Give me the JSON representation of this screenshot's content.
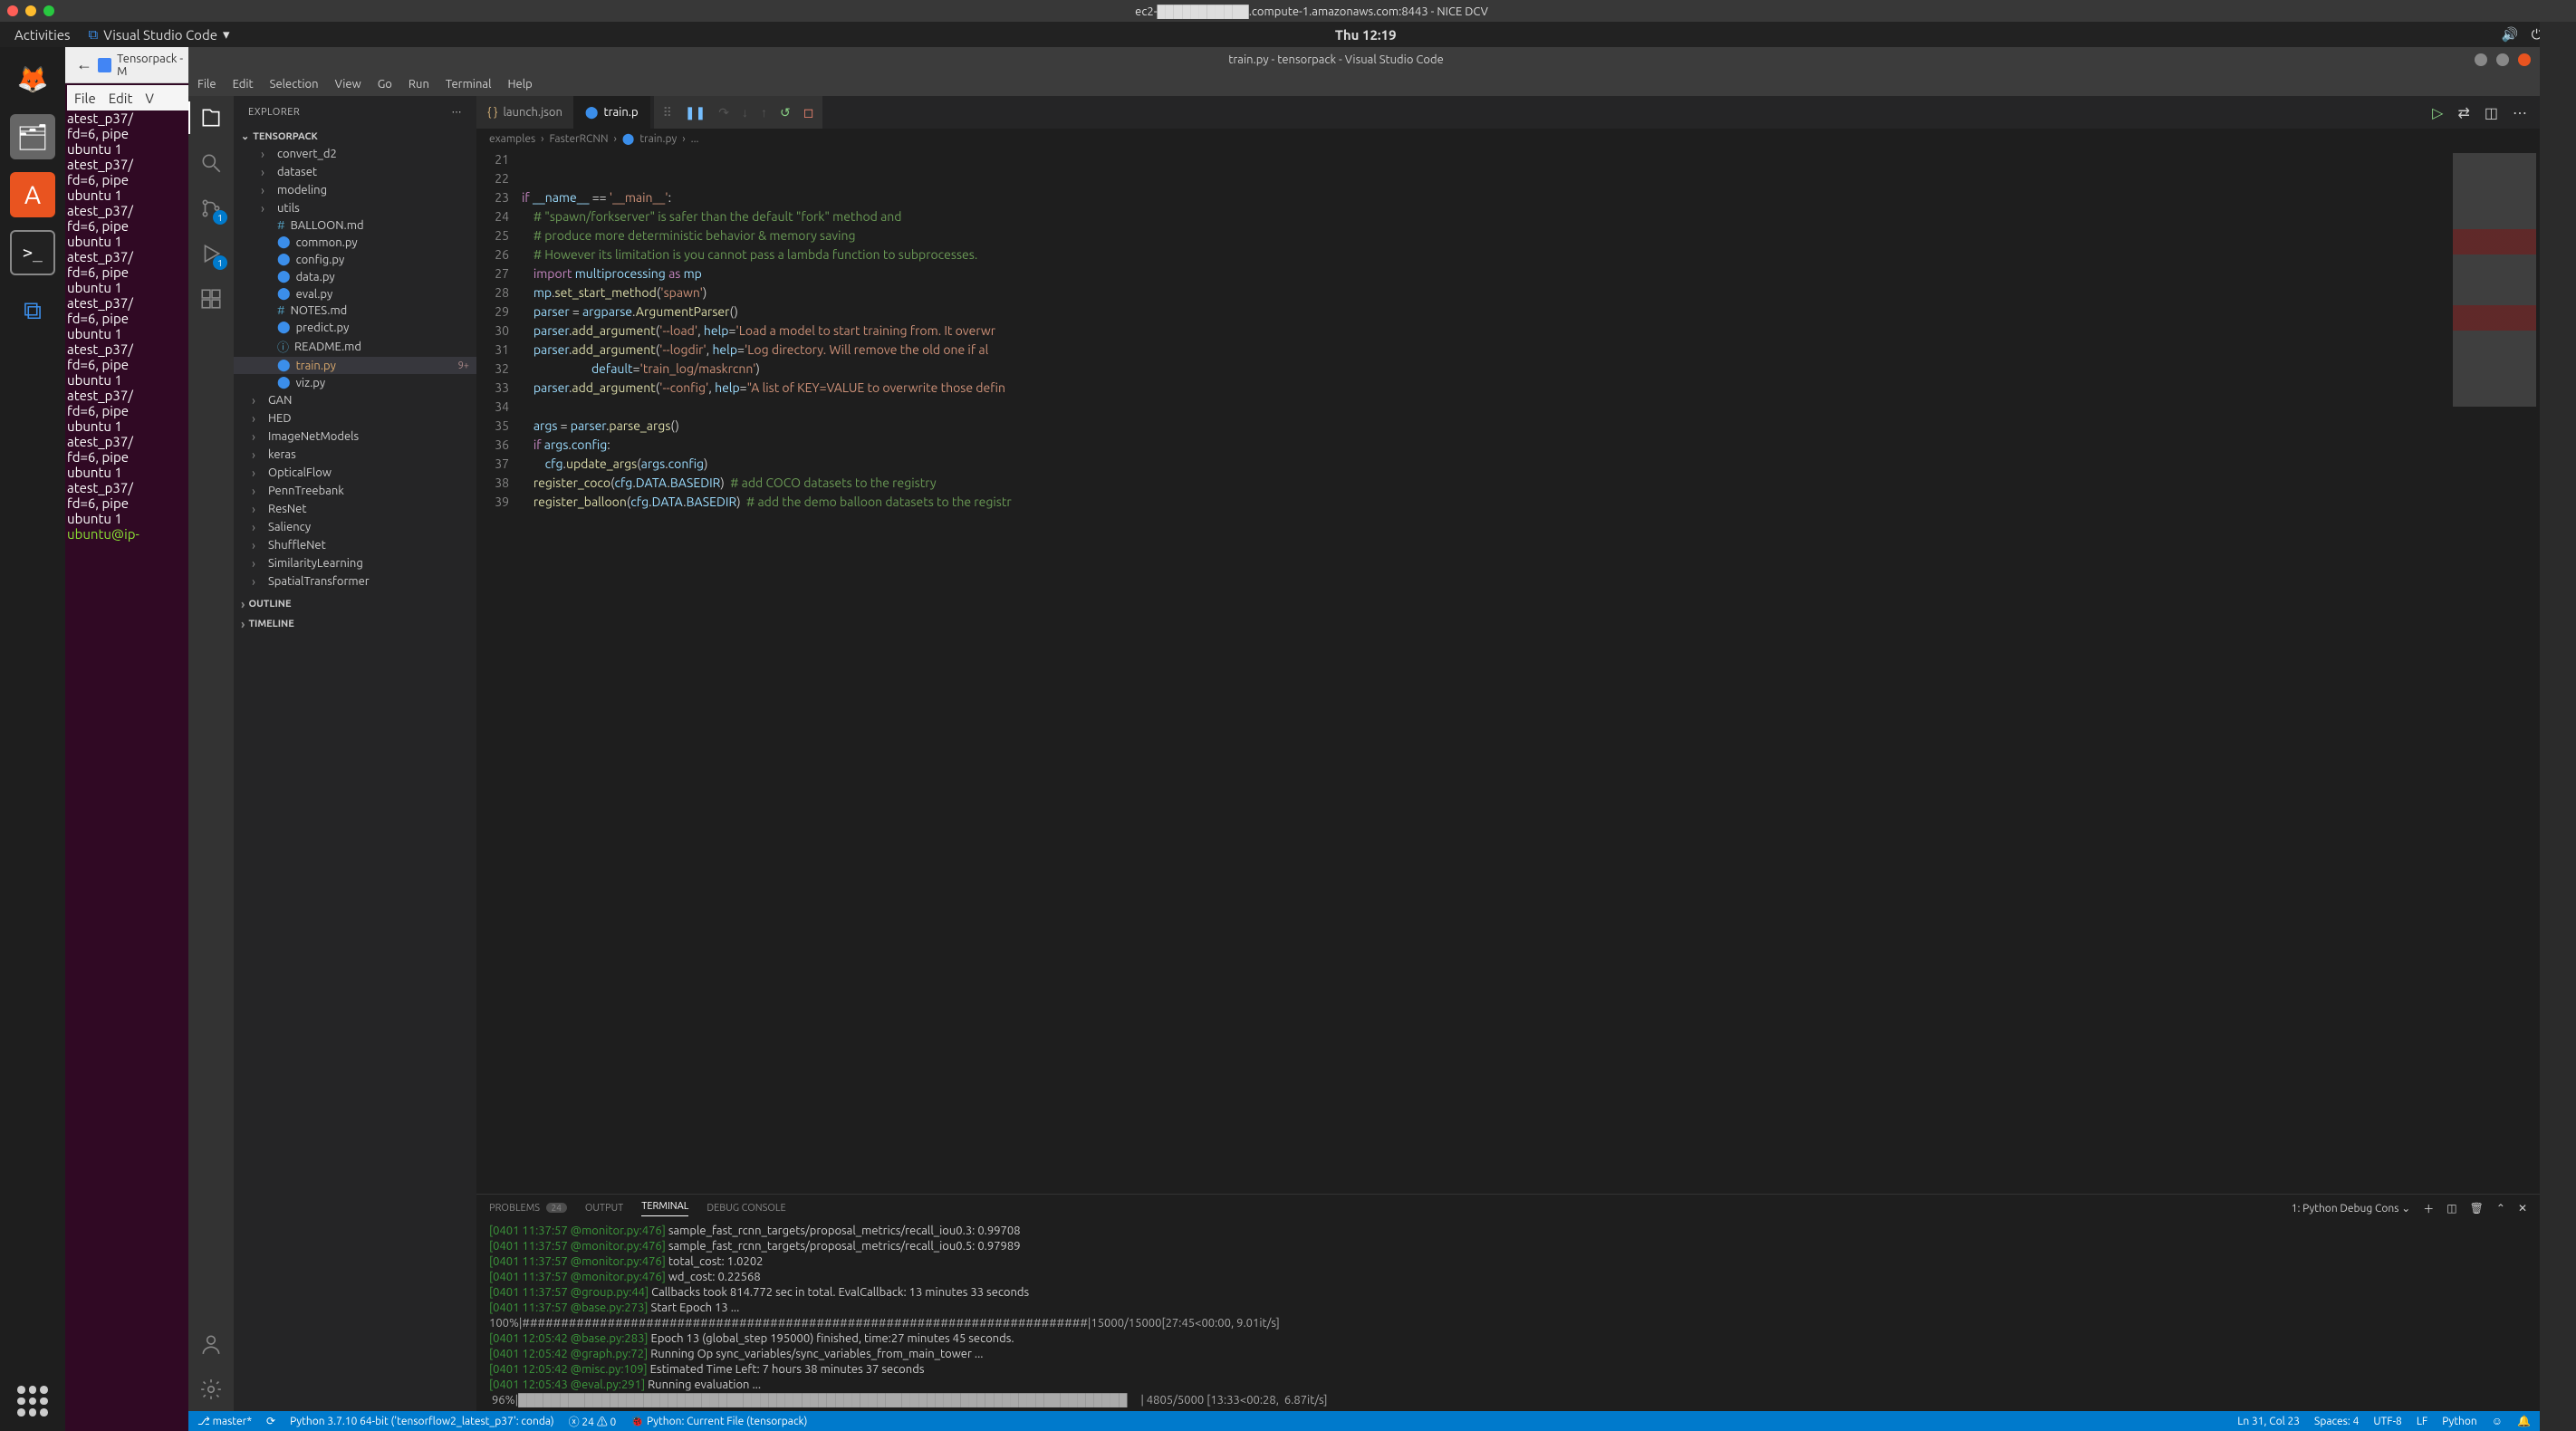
{
  "mac": {
    "title": "ec2-███████████.compute-1.amazonaws.com:8443 - NICE DCV"
  },
  "ubuntu": {
    "activities": "Activities",
    "app": "Visual Studio Code",
    "clock": "Thu 12:19"
  },
  "bg_tab": "Tensorpack - M",
  "bg_term_menu": [
    "File",
    "Edit",
    "V"
  ],
  "bg_term_lines": [
    "atest_p37/",
    "fd=6, pipe",
    "ubuntu   1",
    "atest_p37/",
    "fd=6, pipe",
    "ubuntu   1",
    "atest_p37/",
    "fd=6, pipe",
    "ubuntu   1",
    "atest_p37/",
    "fd=6, pipe",
    "ubuntu   1",
    "atest_p37/",
    "fd=6, pipe",
    "ubuntu   1",
    "atest_p37/",
    "fd=6, pipe",
    "ubuntu   1",
    "atest_p37/",
    "fd=6, pipe",
    "ubuntu   1",
    "atest_p37/",
    "fd=6, pipe",
    "ubuntu   1",
    "atest_p37/",
    "fd=6, pipe",
    "ubuntu   1",
    "ubuntu@ip-"
  ],
  "vscode": {
    "title": "train.py - tensorpack - Visual Studio Code",
    "menu": [
      "File",
      "Edit",
      "Selection",
      "View",
      "Go",
      "Run",
      "Terminal",
      "Help"
    ],
    "explorer": {
      "title": "EXPLORER",
      "root": "TENSORPACK",
      "folders": [
        "convert_d2",
        "dataset",
        "modeling",
        "utils"
      ],
      "files": [
        {
          "n": "BALLOON.md",
          "i": "md"
        },
        {
          "n": "common.py",
          "i": "py"
        },
        {
          "n": "config.py",
          "i": "py"
        },
        {
          "n": "data.py",
          "i": "py"
        },
        {
          "n": "eval.py",
          "i": "py"
        },
        {
          "n": "NOTES.md",
          "i": "md"
        },
        {
          "n": "predict.py",
          "i": "py"
        },
        {
          "n": "README.md",
          "i": "info"
        },
        {
          "n": "train.py",
          "i": "py",
          "sel": true,
          "git": "9+"
        },
        {
          "n": "viz.py",
          "i": "py"
        }
      ],
      "folders2": [
        "GAN",
        "HED",
        "ImageNetModels",
        "keras",
        "OpticalFlow",
        "PennTreebank",
        "ResNet",
        "Saliency",
        "ShuffleNet",
        "SimilarityLearning",
        "SpatialTransformer"
      ],
      "outline": "OUTLINE",
      "timeline": "TIMELINE"
    },
    "badges": {
      "scm": "1",
      "debug": "1"
    },
    "tabs": [
      {
        "label": "launch.json",
        "icon": "{}",
        "active": false
      },
      {
        "label": "train.p",
        "icon": "py",
        "active": true
      }
    ],
    "breadcrumb": [
      "examples",
      "FasterRCNN",
      "train.py",
      "..."
    ],
    "code_lines": [
      {
        "n": 21,
        "t": ""
      },
      {
        "n": 22,
        "t": ""
      },
      {
        "n": 23,
        "h": "<span class='kw'>if</span> <span class='nm'>__name__</span> <span class='op'>==</span> <span class='str'>'__main__'</span>:"
      },
      {
        "n": 24,
        "h": "    <span class='cm'># \"spawn/forkserver\" is safer than the default \"fork\" method and</span>"
      },
      {
        "n": 25,
        "h": "    <span class='cm'># produce more deterministic behavior &amp; memory saving</span>"
      },
      {
        "n": 26,
        "h": "    <span class='cm'># However its limitation is you cannot pass a lambda function to subprocesses.</span>"
      },
      {
        "n": 27,
        "h": "    <span class='kw'>import</span> <span class='nm'>multiprocessing</span> <span class='kw'>as</span> <span class='nm'>mp</span>"
      },
      {
        "n": 28,
        "h": "    <span class='nm'>mp</span>.<span class='fn'>set_start_method</span>(<span class='str'>'spawn'</span>)"
      },
      {
        "n": 29,
        "h": "    <span class='nm'>parser</span> <span class='op'>=</span> <span class='nm'>argparse</span>.<span class='fn'>ArgumentParser</span>()"
      },
      {
        "n": 30,
        "h": "    <span class='nm'>parser</span>.<span class='fn'>add_argument</span>(<span class='str'>'--load'</span>, <span class='nm'>help</span><span class='op'>=</span><span class='str'>'Load a model to start training from. It overwr</span>"
      },
      {
        "n": 31,
        "h": "    <span class='nm'>parser</span>.<span class='fn'>add_argument</span>(<span class='str'>'--logdir'</span>, <span class='nm'>help</span><span class='op'>=</span><span class='str'>'Log directory. Will remove the old one if al</span>"
      },
      {
        "n": 32,
        "h": "                        <span class='nm'>default</span><span class='op'>=</span><span class='str'>'train_log/maskrcnn'</span>)"
      },
      {
        "n": 33,
        "h": "    <span class='nm'>parser</span>.<span class='fn'>add_argument</span>(<span class='str'>'--config'</span>, <span class='nm'>help</span><span class='op'>=</span><span class='str'>\"A list of KEY=VALUE to overwrite those defin</span>"
      },
      {
        "n": 34,
        "h": ""
      },
      {
        "n": 35,
        "h": "    <span class='nm'>args</span> <span class='op'>=</span> <span class='nm'>parser</span>.<span class='fn'>parse_args</span>()"
      },
      {
        "n": 36,
        "h": "    <span class='kw'>if</span> <span class='nm'>args</span>.<span class='nm'>config</span>:"
      },
      {
        "n": 37,
        "h": "        <span class='nm'>cfg</span>.<span class='fn'>update_args</span>(<span class='nm'>args</span>.<span class='nm'>config</span>)"
      },
      {
        "n": 38,
        "h": "    <span class='fn'>register_coco</span>(<span class='nm'>cfg</span>.<span class='nm'>DATA</span>.<span class='nm'>BASEDIR</span>)  <span class='cm'># add COCO datasets to the registry</span>"
      },
      {
        "n": 39,
        "h": "    <span class='fn'>register_balloon</span>(<span class='nm'>cfg</span>.<span class='nm'>DATA</span>.<span class='nm'>BASEDIR</span>)  <span class='cm'># add the demo balloon datasets to the registr</span>"
      }
    ],
    "panel": {
      "tabs": {
        "problems": "PROBLEMS",
        "problems_n": "24",
        "output": "OUTPUT",
        "terminal": "TERMINAL",
        "debug": "DEBUG CONSOLE"
      },
      "selector": "1: Python Debug Cons",
      "lines": [
        {
          "ts": "[0401 11:37:57 @monitor.py:476]",
          "t": " sample_fast_rcnn_targets/proposal_metrics/recall_iou0.3: 0.99708"
        },
        {
          "ts": "[0401 11:37:57 @monitor.py:476]",
          "t": " sample_fast_rcnn_targets/proposal_metrics/recall_iou0.5: 0.97989"
        },
        {
          "ts": "[0401 11:37:57 @monitor.py:476]",
          "t": " total_cost: 1.0202"
        },
        {
          "ts": "[0401 11:37:57 @monitor.py:476]",
          "t": " wd_cost: 0.22568"
        },
        {
          "ts": "[0401 11:37:57 @group.py:44]",
          "t": " Callbacks took 814.772 sec in total. EvalCallback: 13 minutes 33 seconds"
        },
        {
          "ts": "[0401 11:37:57 @base.py:273]",
          "t": " Start Epoch 13 ..."
        },
        {
          "prog": "100%|#########################################################################|15000/15000[27:45<00:00, 9.01it/s]"
        },
        {
          "ts": "[0401 12:05:42 @base.py:283]",
          "t": " Epoch 13 (global_step 195000) finished, time:27 minutes 45 seconds."
        },
        {
          "ts": "[0401 12:05:42 @graph.py:72]",
          "t": " Running Op sync_variables/sync_variables_from_main_tower ..."
        },
        {
          "ts": "[0401 12:05:42 @misc.py:109]",
          "t": " Estimated Time Left: 7 hours 38 minutes 37 seconds"
        },
        {
          "ts": "[0401 12:05:43 @eval.py:291]",
          "t": " Running evaluation ..."
        },
        {
          "prog": " 96%|█████████████████████████████████████████████████████████████████████████     | 4805/5000 [13:33<00:28,  6.87it/s]"
        }
      ]
    },
    "status": {
      "branch": "master*",
      "sync": "",
      "python": "Python 3.7.10 64-bit ('tensorflow2_latest_p37': conda)",
      "errors": "24",
      "warnings": "0",
      "debug": "Python: Current File (tensorpack)",
      "ln": "Ln 31, Col 23",
      "spaces": "Spaces: 4",
      "enc": "UTF-8",
      "eol": "LF",
      "lang": "Python"
    }
  }
}
